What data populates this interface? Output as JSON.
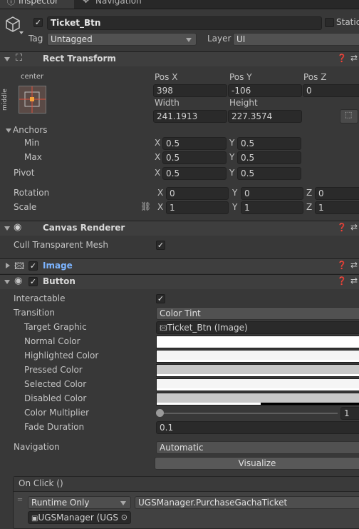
{
  "tabs": {
    "inspector": "Inspector",
    "navigation": "Navigation"
  },
  "header": {
    "name": "Ticket_Btn",
    "static_label": "Static",
    "tag_label": "Tag",
    "tag_value": "Untagged",
    "layer_label": "Layer",
    "layer_value": "UI"
  },
  "rect_transform": {
    "title": "Rect Transform",
    "anchor_preset_h": "center",
    "anchor_preset_v": "middle",
    "posx_label": "Pos X",
    "posy_label": "Pos Y",
    "posz_label": "Pos Z",
    "posx": "398",
    "posy": "-106",
    "posz": "0",
    "width_label": "Width",
    "height_label": "Height",
    "width": "241.1913",
    "height": "227.3574",
    "anchors_label": "Anchors",
    "min_label": "Min",
    "max_label": "Max",
    "pivot_label": "Pivot",
    "min_x": "0.5",
    "min_y": "0.5",
    "max_x": "0.5",
    "max_y": "0.5",
    "pivot_x": "0.5",
    "pivot_y": "0.5",
    "rotation_label": "Rotation",
    "rot_x": "0",
    "rot_y": "0",
    "rot_z": "0",
    "scale_label": "Scale",
    "scale_x": "1",
    "scale_y": "1",
    "scale_z": "1",
    "x": "X",
    "y": "Y",
    "z": "Z"
  },
  "canvas_renderer": {
    "title": "Canvas Renderer",
    "cull_label": "Cull Transparent Mesh"
  },
  "image": {
    "title": "Image"
  },
  "button": {
    "title": "Button",
    "interactable_label": "Interactable",
    "transition_label": "Transition",
    "transition_value": "Color Tint",
    "target_graphic_label": "Target Graphic",
    "target_graphic_value": "Ticket_Btn (Image)",
    "normal_label": "Normal Color",
    "highlighted_label": "Highlighted Color",
    "pressed_label": "Pressed Color",
    "selected_label": "Selected Color",
    "disabled_label": "Disabled Color",
    "multiplier_label": "Color Multiplier",
    "multiplier_value": "1",
    "fade_label": "Fade Duration",
    "fade_value": "0.1",
    "navigation_label": "Navigation",
    "navigation_value": "Automatic",
    "visualize_label": "Visualize"
  },
  "onclick": {
    "title": "On Click ()",
    "mode": "Runtime Only",
    "function": "UGSManager.PurchaseGachaTicket",
    "object": "UGSManager (UGS"
  },
  "colors": {
    "normal": "#ffffff",
    "highlighted": "#f5f5f5",
    "pressed": "#c8c8c8",
    "selected": "#f5f5f5",
    "disabled": "#c8c8c8",
    "accent_image": "#7cb4ff"
  },
  "icons": [
    "gameobject-cube-icon",
    "rect-transform-icon",
    "eye-icon",
    "image-component-icon",
    "button-component-icon",
    "help-icon",
    "presets-icon",
    "link-icon",
    "object-picker-icon"
  ]
}
